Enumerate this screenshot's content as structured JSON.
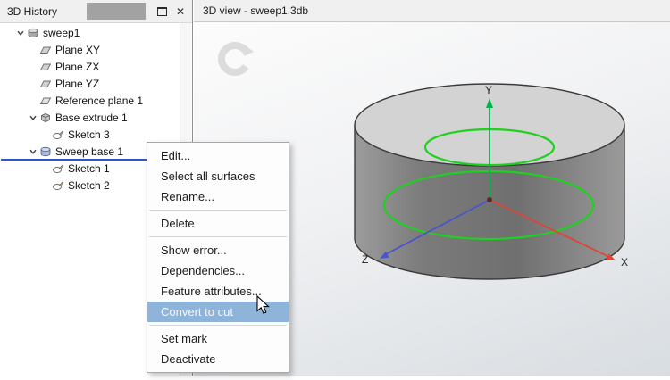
{
  "left_panel": {
    "title": "3D History",
    "icons": {
      "close": "✕"
    },
    "tree": [
      {
        "label": "sweep1"
      },
      {
        "label": "Plane XY"
      },
      {
        "label": "Plane ZX"
      },
      {
        "label": "Plane YZ"
      },
      {
        "label": "Reference plane 1"
      },
      {
        "label": "Base extrude 1"
      },
      {
        "label": "Sketch 3"
      },
      {
        "label": "Sweep base 1"
      },
      {
        "label": "Sketch 1"
      },
      {
        "label": "Sketch 2"
      }
    ]
  },
  "context_menu": {
    "items": [
      "Edit...",
      "Select all surfaces",
      "Rename...",
      "Delete",
      "Show error...",
      "Dependencies...",
      "Feature attributes...",
      "Convert to cut",
      "Set mark",
      "Deactivate"
    ],
    "highlighted_item": "Convert to cut"
  },
  "right_panel": {
    "title": "3D view - sweep1.3db",
    "axis_labels": {
      "x": "X",
      "y": "Y",
      "z": "Z"
    }
  },
  "colors": {
    "axis_x": "#e04438",
    "axis_y": "#00b44c",
    "axis_z": "#4a55cc",
    "sketch_green": "#1fd11f",
    "menu_highlight": "#8fb4da",
    "drop_indicator": "#2f55cc"
  }
}
